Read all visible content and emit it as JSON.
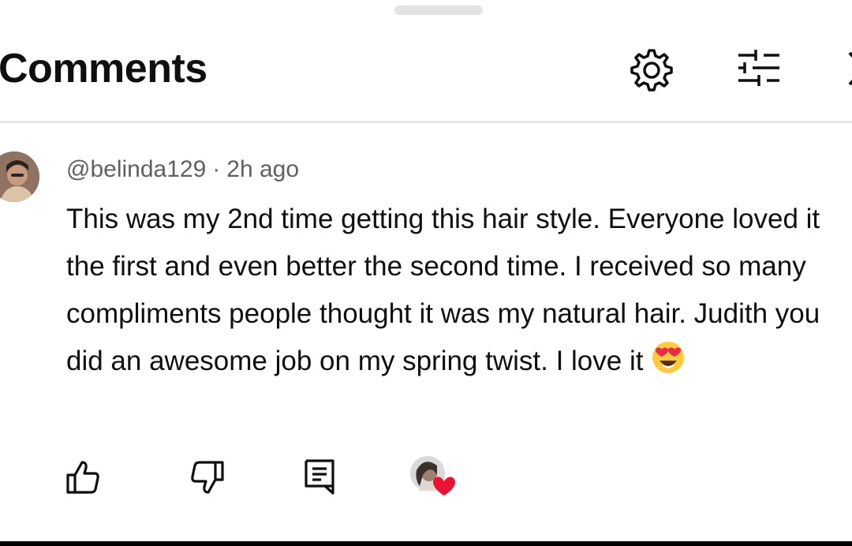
{
  "header": {
    "title": "Comments",
    "icons": [
      "gear-icon",
      "filter-sliders-icon",
      "close-icon"
    ]
  },
  "comment": {
    "author": "@belinda129",
    "separator": "·",
    "time": "2h ago",
    "text": "This was my 2nd time getting this hair style. Everyone loved it the first and even better the second time. I received so many compliments people thought it was my natural hair. Judith you did an awesome job on my spring twist. I love it",
    "emoji": "smiling-face-with-heart-eyes",
    "actions": [
      "thumbs-up-icon",
      "thumbs-down-icon",
      "reply-icon",
      "creator-heart"
    ]
  },
  "colors": {
    "text": "#0f0f0f",
    "secondary_text": "#606060",
    "divider": "#e6e6e6",
    "heart": "#ee1133"
  }
}
